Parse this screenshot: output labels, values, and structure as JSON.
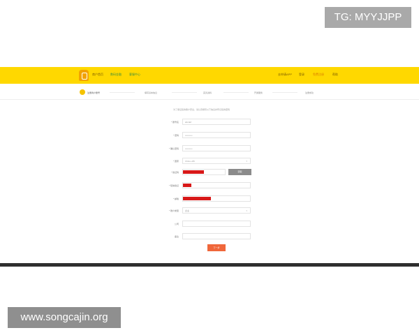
{
  "watermarks": {
    "top": "TG: MYYJJPP",
    "bottom": "www.songcajin.org"
  },
  "header": {
    "nav_left": [
      "商户首页",
      "数码金融",
      "客服中心"
    ],
    "nav_right": [
      "去申请APP",
      "登录",
      "免费注册",
      "帮助"
    ]
  },
  "steps": [
    "注册商户账号",
    "填写基本信息",
    "完善资料",
    "开通服务",
    "注册成功"
  ],
  "form": {
    "notice": "为了保证您的账户安全，请认真填写以下信息并牢记您的密码",
    "username": {
      "label": "* 账号名",
      "value": "abcdef"
    },
    "password": {
      "label": "* 密码",
      "value": "••••••••••"
    },
    "confirm": {
      "label": "* 确认密码",
      "value": "••••••••••"
    },
    "region": {
      "label": "* 国家",
      "value": "China +86"
    },
    "code": {
      "label": "* 验证码",
      "button": "获取"
    },
    "sms": {
      "label": "* 短信验证"
    },
    "email": {
      "label": "* 邮箱"
    },
    "type": {
      "label": "* 账户类型",
      "value": "企业"
    },
    "company": {
      "label": "公司"
    },
    "remark": {
      "label": "备注"
    },
    "next_button": "下一步"
  },
  "colors": {
    "topbar": "#ffd800",
    "accent": "#f0673b",
    "redact": "#d81818"
  }
}
